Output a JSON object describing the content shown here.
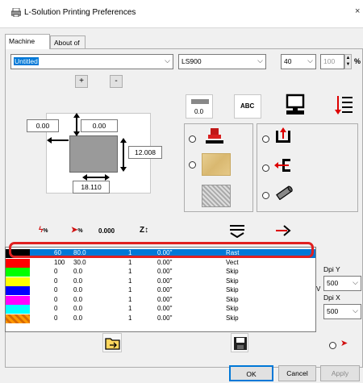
{
  "window": {
    "title": "L-Solution Printing Preferences",
    "close": "×"
  },
  "tabs": [
    {
      "label": "Machine"
    },
    {
      "label": "About of"
    }
  ],
  "controls": {
    "profile": "Untitled",
    "machine": "LS900",
    "power": "40",
    "speed": "100",
    "percent": "%",
    "add": "+",
    "remove": "-",
    "offset_left": "0.00",
    "offset_top": "0.00",
    "height": "12.008",
    "width": "18.110",
    "line_value": "0.0",
    "abc": "ABC"
  },
  "columns": [
    {
      "icon": "power-percent-icon",
      "label": "%"
    },
    {
      "icon": "speed-percent-icon",
      "label": "%"
    },
    {
      "icon": "frequency-icon",
      "label": "0.000"
    },
    {
      "icon": "z-offset-icon",
      "label": "Z↕"
    },
    {
      "icon": "mode-icon",
      "label": ""
    },
    {
      "icon": "output-icon",
      "label": ""
    }
  ],
  "rows": [
    {
      "color": "#000000",
      "power": "60",
      "speed": "80.0",
      "passes": "1",
      "z": "0.00\"",
      "mode": "Rast",
      "selected": true
    },
    {
      "color": "#ff0000",
      "power": "100",
      "speed": "30.0",
      "passes": "1",
      "z": "0.00\"",
      "mode": "Vect",
      "selected": false
    },
    {
      "color": "#00ff00",
      "power": "0",
      "speed": "0.0",
      "passes": "1",
      "z": "0.00\"",
      "mode": "Skip",
      "selected": false
    },
    {
      "color": "#ffff00",
      "power": "0",
      "speed": "0.0",
      "passes": "1",
      "z": "0.00\"",
      "mode": "Skip",
      "selected": false
    },
    {
      "color": "#0000ff",
      "power": "0",
      "speed": "0.0",
      "passes": "1",
      "z": "0.00\"",
      "mode": "Skip",
      "selected": false
    },
    {
      "color": "#ff00ff",
      "power": "0",
      "speed": "0.0",
      "passes": "1",
      "z": "0.00\"",
      "mode": "Skip",
      "selected": false
    },
    {
      "color": "#00ffff",
      "power": "0",
      "speed": "0.0",
      "passes": "1",
      "z": "0.00\"",
      "mode": "Skip",
      "selected": false
    },
    {
      "color": "#ff9900",
      "power": "0",
      "speed": "0.0",
      "passes": "1",
      "z": "0.00\"",
      "mode": "Skip",
      "selected": false
    }
  ],
  "dpi": {
    "y_label": "Dpi Y",
    "y_value": "500",
    "x_label": "Dpi X",
    "x_value": "500",
    "v_label": "V"
  },
  "buttons": {
    "ok": "OK",
    "cancel": "Cancel",
    "apply": "Apply"
  },
  "accent": "#0078d7",
  "highlight_border": "#e02020"
}
